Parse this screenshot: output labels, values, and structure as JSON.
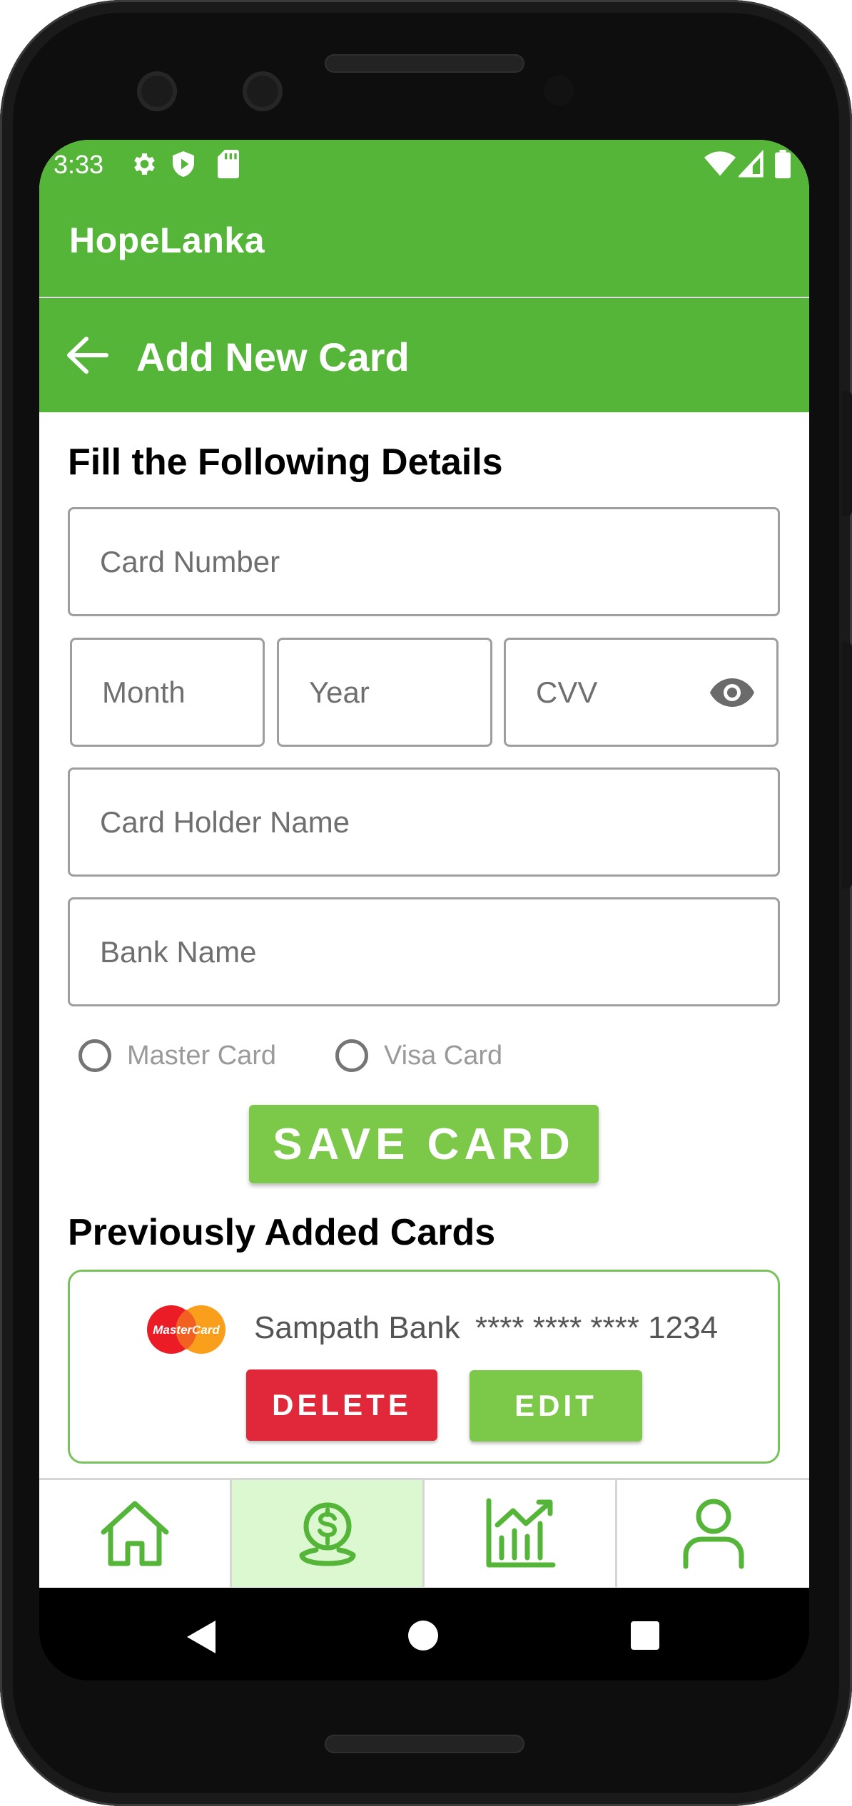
{
  "status_bar": {
    "time": "3:33",
    "left_icons": [
      "gear-icon",
      "shield-icon",
      "sd-card-icon"
    ],
    "right_icons": [
      "wifi-icon",
      "cell-signal-icon",
      "battery-icon"
    ]
  },
  "app_bar": {
    "title": "HopeLanka"
  },
  "header": {
    "title": "Add New Card",
    "back_icon": "arrow-left-icon"
  },
  "form": {
    "heading": "Fill the Following Details",
    "card_number": {
      "placeholder": "Card Number",
      "value": ""
    },
    "month": {
      "placeholder": "Month",
      "value": ""
    },
    "year": {
      "placeholder": "Year",
      "value": ""
    },
    "cvv": {
      "placeholder": "CVV",
      "value": "",
      "toggle_icon": "eye-icon"
    },
    "holder_name": {
      "placeholder": "Card Holder Name",
      "value": ""
    },
    "bank_name": {
      "placeholder": "Bank Name",
      "value": ""
    },
    "card_types": [
      {
        "label": "Master Card",
        "selected": false
      },
      {
        "label": "Visa Card",
        "selected": false
      }
    ],
    "save_label": "SAVE CARD"
  },
  "saved_cards": {
    "heading": "Previously Added Cards",
    "items": [
      {
        "brand": "MasterCard",
        "bank": "Sampath Bank",
        "number": "**** **** **** 1234",
        "delete_label": "DELETE",
        "edit_label": "EDIT"
      }
    ]
  },
  "bottom_nav": [
    {
      "icon": "home-icon",
      "active": false
    },
    {
      "icon": "dollar-coin-icon",
      "active": true
    },
    {
      "icon": "chart-icon",
      "active": false
    },
    {
      "icon": "person-icon",
      "active": false
    }
  ],
  "colors": {
    "primary_green": "#55b539",
    "button_green": "#7cc94a",
    "delete_red": "#e0283a",
    "active_tab": "#dcf8d0"
  }
}
